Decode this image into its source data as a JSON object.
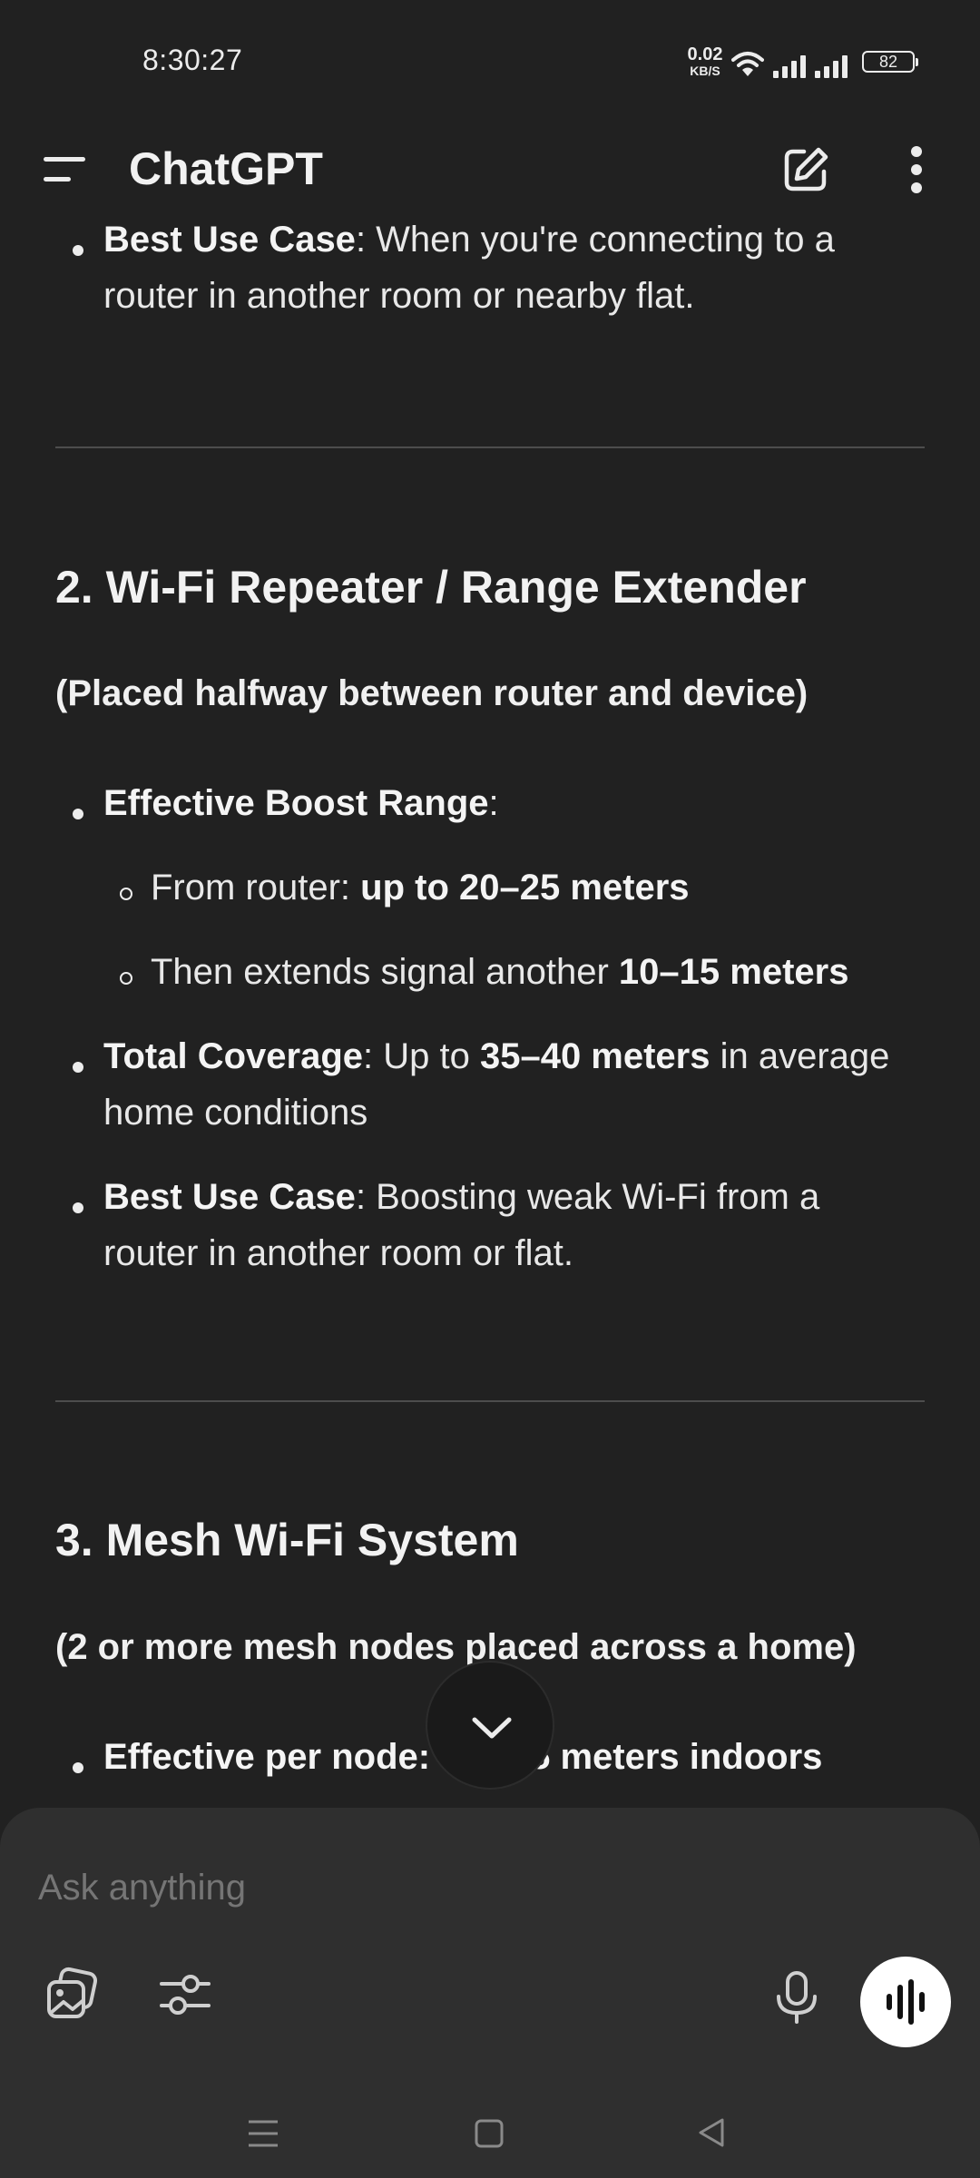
{
  "status_bar": {
    "time": "8:30:27",
    "net_speed_value": "0.02",
    "net_speed_unit": "KB/S",
    "battery": "82"
  },
  "header": {
    "title": "ChatGPT"
  },
  "content": {
    "top_item": {
      "label": "Best Use Case",
      "line1_rest": ": When you're connecting to a",
      "line2": "router in another room or nearby flat."
    },
    "section2": {
      "heading": "2. Wi-Fi Repeater / Range Extender",
      "subheading": "(Placed halfway between router and device)",
      "effective_label": "Effective Boost Range",
      "effective_colon": ":",
      "sub1_prefix": "From router: ",
      "sub1_bold": "up to 20–25 meters",
      "sub2_prefix": "Then extends signal another ",
      "sub2_bold": "10–15 meters",
      "total_label": "Total Coverage",
      "total_mid": ": Up to ",
      "total_bold": "35–40 meters",
      "total_end": " in average",
      "total_line2": "home conditions",
      "best_label": "Best Use Case",
      "best_line1_rest": ": Boosting weak Wi-Fi from a",
      "best_line2": "router in another room or flat."
    },
    "section3": {
      "heading": "3. Mesh Wi-Fi System",
      "subheading": "(2 or more mesh nodes placed across a home)",
      "partial_label": "Effective per node:",
      "partial_rest": "5 meters indoors"
    }
  },
  "composer": {
    "placeholder": "Ask anything"
  },
  "icons": {
    "menu": "menu-icon",
    "edit": "edit-icon",
    "more": "more-vertical-icon",
    "scroll_down": "chevron-down-icon",
    "image": "image-icon",
    "tools": "sliders-icon",
    "mic": "mic-icon",
    "voice": "voice-waveform-icon"
  },
  "colors": {
    "background": "#212121",
    "composer": "#2f2f2f",
    "text": "#ececec",
    "divider": "#4d4d4d"
  }
}
